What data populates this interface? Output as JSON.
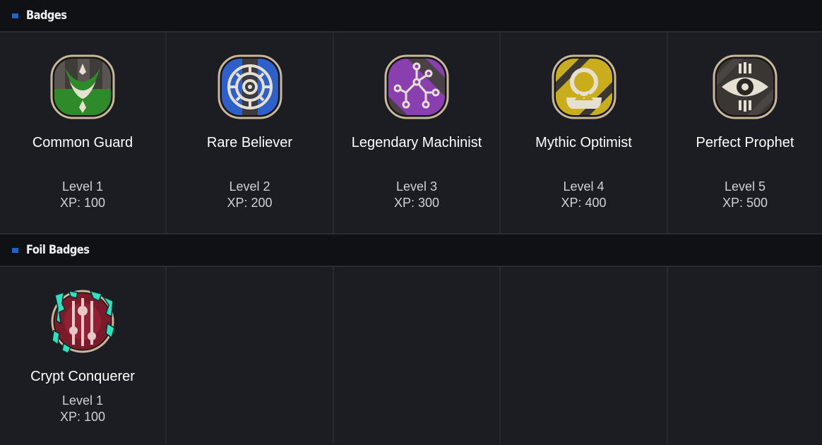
{
  "sections": {
    "badges": {
      "title": "Badges"
    },
    "foil": {
      "title": "Foil Badges"
    }
  },
  "badges": [
    {
      "name": "Common Guard",
      "level": "Level 1",
      "xp": "XP: 100",
      "icon": "guard-icon",
      "color": "#2f8a2a"
    },
    {
      "name": "Rare Believer",
      "level": "Level 2",
      "xp": "XP: 200",
      "icon": "rune-circle-icon",
      "color": "#2f5fc8"
    },
    {
      "name": "Legendary Machinist",
      "level": "Level 3",
      "xp": "XP: 300",
      "icon": "circuit-icon",
      "color": "#8a3fb0"
    },
    {
      "name": "Mythic Optimist",
      "level": "Level 4",
      "xp": "XP: 400",
      "icon": "sun-emblem-icon",
      "color": "#c9ad1c"
    },
    {
      "name": "Perfect Prophet",
      "level": "Level 5",
      "xp": "XP: 500",
      "icon": "eye-icon",
      "color": "#3a3633"
    }
  ],
  "foil_badges": [
    {
      "name": "Crypt Conquerer",
      "level": "Level 1",
      "xp": "XP: 100",
      "icon": "crypt-sliders-icon",
      "color": "#7a1a2a",
      "accent": "#2ee0c0"
    }
  ]
}
